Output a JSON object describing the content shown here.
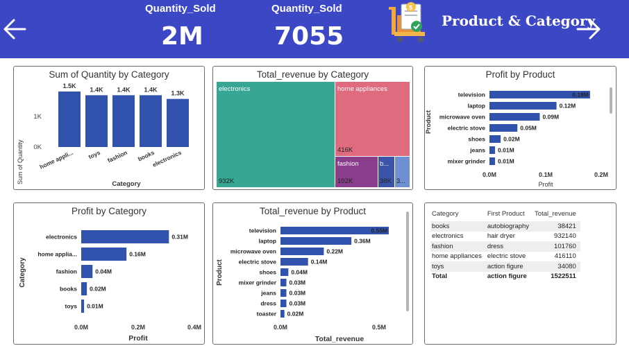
{
  "header": {
    "kpi1": {
      "label": "Quantity_Sold",
      "value": "2M"
    },
    "kpi2": {
      "label": "Quantity_Sold",
      "value": "7055"
    },
    "title": "Product & Category",
    "bg_color": "#3b47c4"
  },
  "colors": {
    "bar": "#3253ad"
  },
  "visuals": {
    "qty_by_category": {
      "title": "Sum of Quantity by Category",
      "xlabel": "Category",
      "ylabel": "Sum of Quantity",
      "yticks": [
        "1K",
        "0K"
      ]
    },
    "revenue_treemap": {
      "title": "Total_revenue by Category",
      "tiles": [
        {
          "label": "electronics",
          "value": "932K",
          "color": "#37a793"
        },
        {
          "label": "home appliances",
          "value": "416K",
          "color": "#df6b7f"
        },
        {
          "label": "fashion",
          "value": "102K",
          "color": "#893d8a"
        },
        {
          "label": "b...",
          "value": "38K",
          "color": "#3a55a8"
        },
        {
          "label": "3...",
          "value": "",
          "color": "#6e8fd2"
        }
      ]
    },
    "profit_by_product_top": {
      "title": "Profit by Product",
      "xlabel": "Profit",
      "ylabel": "Product",
      "xticks": [
        "0.0M",
        "0.1M",
        "0.2M"
      ]
    },
    "profit_by_category": {
      "title": "Profit by Category",
      "xlabel": "Profit",
      "ylabel": "Category",
      "xticks": [
        "0.0M",
        "0.2M",
        "0.4M"
      ]
    },
    "revenue_by_product": {
      "title": "Total_revenue by Product",
      "xlabel": "Total_revenue",
      "ylabel": "Product",
      "xticks": [
        "0.0M",
        "0.5M"
      ]
    },
    "category_table": {
      "headers": [
        "Category",
        "First Product",
        "Total_revenue"
      ],
      "rows": [
        [
          "books",
          "autobiography",
          "38421"
        ],
        [
          "electronics",
          "hair dryer",
          "932140"
        ],
        [
          "fashion",
          "dress",
          "101760"
        ],
        [
          "home appliances",
          "electric stove",
          "416110"
        ],
        [
          "toys",
          "action figure",
          "34080"
        ]
      ],
      "total": [
        "Total",
        "action figure",
        "1522511"
      ]
    }
  },
  "chart_data": [
    {
      "type": "bar",
      "title": "Sum of Quantity by Category",
      "xlabel": "Category",
      "ylabel": "Sum of Quantity",
      "categories": [
        "home appli...",
        "toys",
        "fashion",
        "books",
        "electronics"
      ],
      "values": [
        1500,
        1400,
        1400,
        1400,
        1300
      ],
      "labels": [
        "1.5K",
        "1.4K",
        "1.4K",
        "1.4K",
        "1.3K"
      ],
      "ylim": [
        0,
        1800
      ]
    },
    {
      "type": "bar",
      "orientation": "horizontal",
      "title": "Profit by Product",
      "xlabel": "Profit",
      "ylabel": "Product",
      "categories": [
        "television",
        "laptop",
        "microwave oven",
        "electric stove",
        "shoes",
        "jeans",
        "mixer grinder"
      ],
      "values": [
        0.18,
        0.12,
        0.09,
        0.05,
        0.02,
        0.01,
        0.01
      ],
      "labels": [
        "0.18M",
        "0.12M",
        "0.09M",
        "0.05M",
        "0.02M",
        "0.01M",
        "0.01M"
      ],
      "xlim": [
        0,
        0.2
      ]
    },
    {
      "type": "bar",
      "orientation": "horizontal",
      "title": "Profit by Category",
      "xlabel": "Profit",
      "ylabel": "Category",
      "categories": [
        "electronics",
        "home applia...",
        "fashion",
        "books",
        "toys"
      ],
      "values": [
        0.31,
        0.16,
        0.04,
        0.02,
        0.01
      ],
      "labels": [
        "0.31M",
        "0.16M",
        "0.04M",
        "0.02M",
        "0.01M"
      ],
      "xlim": [
        0,
        0.4
      ]
    },
    {
      "type": "bar",
      "orientation": "horizontal",
      "title": "Total_revenue by Product",
      "xlabel": "Total_revenue",
      "ylabel": "Product",
      "categories": [
        "television",
        "laptop",
        "microwave oven",
        "electric stove",
        "shoes",
        "mixer grinder",
        "jeans",
        "dress",
        "toaster"
      ],
      "values": [
        0.55,
        0.36,
        0.22,
        0.14,
        0.04,
        0.03,
        0.03,
        0.03,
        0.02
      ],
      "labels": [
        "0.55M",
        "0.36M",
        "0.22M",
        "0.14M",
        "0.04M",
        "0.03M",
        "0.03M",
        "0.03M",
        "0.02M"
      ],
      "xlim": [
        0,
        0.55
      ]
    }
  ]
}
